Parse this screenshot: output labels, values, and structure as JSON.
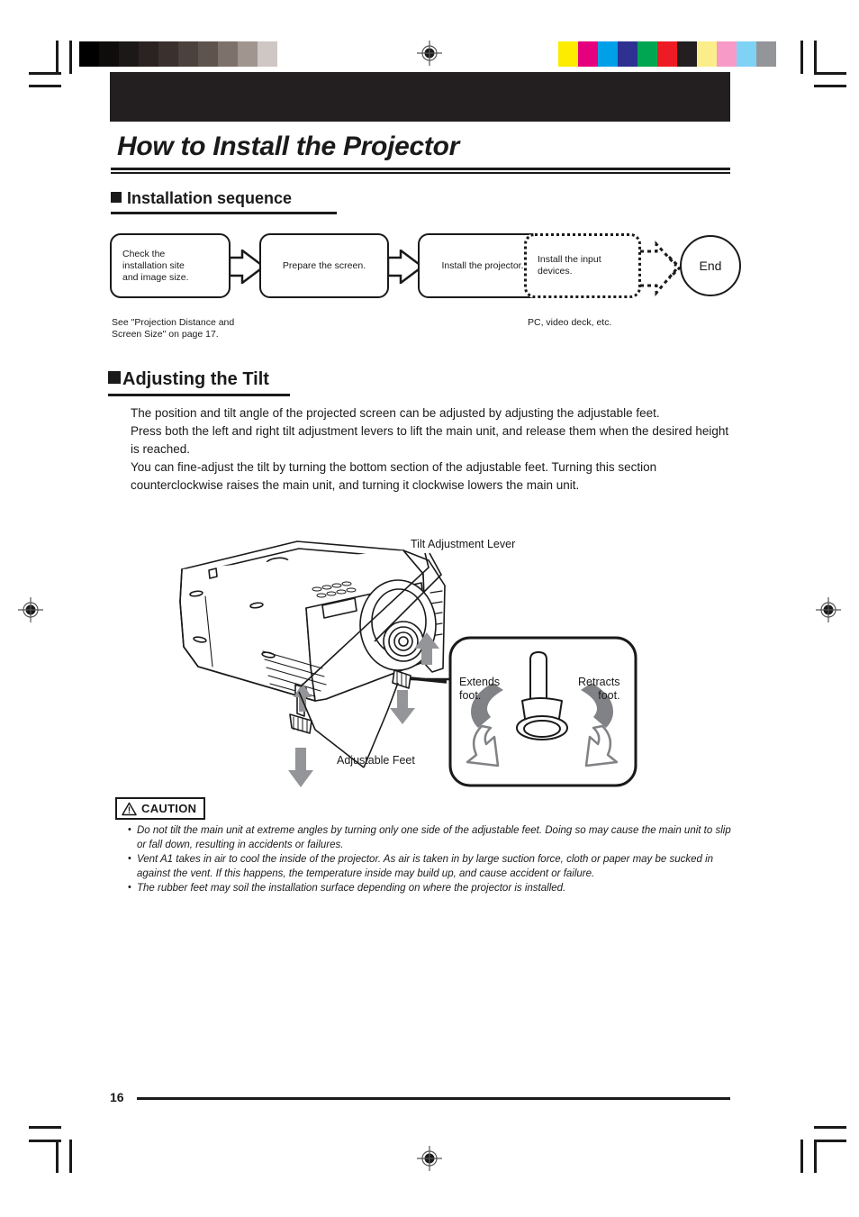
{
  "document": {
    "page_title": "How to Install the Projector",
    "page_number": "16"
  },
  "sections": {
    "installation_sequence": {
      "heading": "Installation sequence"
    },
    "adjusting_tilt": {
      "heading": "Adjusting the Tilt",
      "paragraphs": [
        "The position and tilt angle of the projected screen can be adjusted by adjusting the adjustable feet.",
        "Press both the left and right tilt adjustment levers to lift the main unit, and release them when the desired height is reached.",
        "You can fine-adjust the tilt by turning the bottom section of the adjustable feet. Turning this section counterclockwise raises the main unit, and turning it clockwise lowers the main unit."
      ]
    }
  },
  "flowchart": {
    "steps": [
      {
        "label": "Check the\ninstallation site\nand image size.",
        "style": "solid"
      },
      {
        "label": "Prepare the screen.",
        "style": "solid"
      },
      {
        "label": "Install the projector.",
        "style": "solid"
      },
      {
        "label": "Install the input\ndevices.",
        "style": "dashed"
      }
    ],
    "end_node": "End",
    "notes": {
      "left": "See \"Projection Distance and\nScreen Size\" on page 17.",
      "right": "PC, video deck, etc."
    }
  },
  "illustration": {
    "labels": {
      "tilt_lever": "Tilt Adjustment Lever",
      "adjustable_feet": "Adjustable Feet",
      "extends": "Extends\nfoot.",
      "retracts": "Retracts\nfoot."
    }
  },
  "caution": {
    "title": "CAUTION",
    "items": [
      "Do not tilt the main unit at extreme angles by turning only one side of the adjustable feet. Doing so may cause the main unit to slip or fall down, resulting in accidents or failures.",
      "Vent A1 takes in air to cool the inside of the projector. As air is taken in by large suction force, cloth or paper may be sucked in against the vent. If this happens, the temperature inside may build up, and cause accident or failure.",
      "The rubber feet may soil the installation surface depending on where the projector is installed."
    ]
  },
  "print_marks": {
    "grayscale_patches": [
      "#000000",
      "#0f0c0c",
      "#1d1818",
      "#2a2321",
      "#3a312e",
      "#4b413d",
      "#5f534e",
      "#7d716c",
      "#a0958f",
      "#cfc7c3",
      "#ffffff"
    ],
    "color_patches": [
      "#fdec00",
      "#e5007e",
      "#00a0e9",
      "#2e3192",
      "#00a651",
      "#ed1c24",
      "#231f20",
      "#fbee8a",
      "#f79ac8",
      "#7ed3f5",
      "#939598"
    ]
  }
}
